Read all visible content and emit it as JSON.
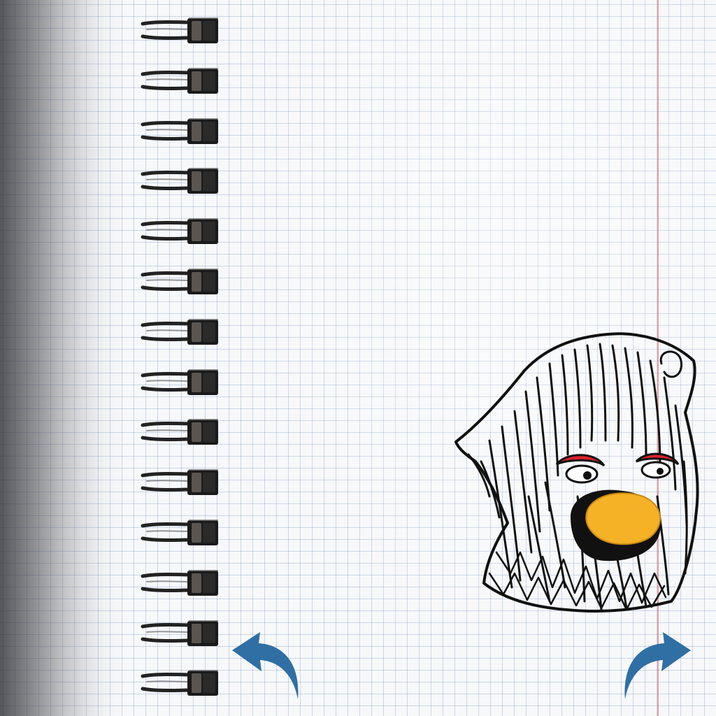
{
  "notebook": {
    "ring_count": 14,
    "paper_color": "#f7f8fa",
    "grid_color": "#7896be",
    "margin_line_color": "#e6505a"
  },
  "navigation": {
    "back_icon": "curved-arrow-left-icon",
    "forward_icon": "curved-arrow-right-icon",
    "arrow_color": "#2f6fa4"
  },
  "drawing": {
    "subject": "hooded-face-doodle",
    "eye_color": "#e0202a",
    "mouth_color": "#f6b226",
    "ink_color": "#111111"
  }
}
